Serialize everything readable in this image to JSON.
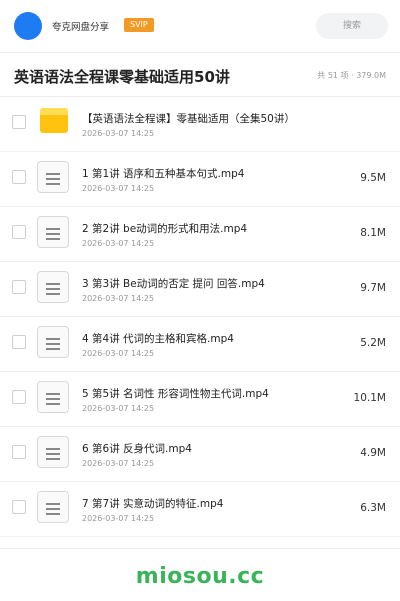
{
  "header": {
    "app_name": "夸克网盘分享",
    "badge": "SVIP",
    "search_placeholder": "搜索"
  },
  "title_bar": {
    "title": "英语语法全程课零基础适用50讲",
    "summary": "共 51 项 · 379.0M"
  },
  "files": [
    {
      "type": "folder",
      "name": "【英语语法全程课】零基础适用（全集50讲）",
      "date": "2026-03-07 14:25",
      "size": ""
    },
    {
      "type": "file",
      "name": "1 第1讲 语序和五种基本句式.mp4",
      "date": "2026-03-07 14:25",
      "size": "9.5M"
    },
    {
      "type": "file",
      "name": "2 第2讲 be动词的形式和用法.mp4",
      "date": "2026-03-07 14:25",
      "size": "8.1M"
    },
    {
      "type": "file",
      "name": "3 第3讲 Be动词的否定 提问 回答.mp4",
      "date": "2026-03-07 14:25",
      "size": "9.7M"
    },
    {
      "type": "file",
      "name": "4 第4讲 代词的主格和宾格.mp4",
      "date": "2026-03-07 14:25",
      "size": "5.2M"
    },
    {
      "type": "file",
      "name": "5 第5讲 名词性 形容词性物主代词.mp4",
      "date": "2026-03-07 14:25",
      "size": "10.1M"
    },
    {
      "type": "file",
      "name": "6 第6讲 反身代词.mp4",
      "date": "2026-03-07 14:25",
      "size": "4.9M"
    },
    {
      "type": "file",
      "name": "7 第7讲 实意动词的特征.mp4",
      "date": "2026-03-07 14:25",
      "size": "6.3M"
    }
  ],
  "footer": {
    "brand": "miosou.cc"
  },
  "colors": {
    "avatar": "#1e7cf2",
    "badge": "#f39a26",
    "folder": "#ffc20e",
    "brand": "#3bb35a"
  }
}
